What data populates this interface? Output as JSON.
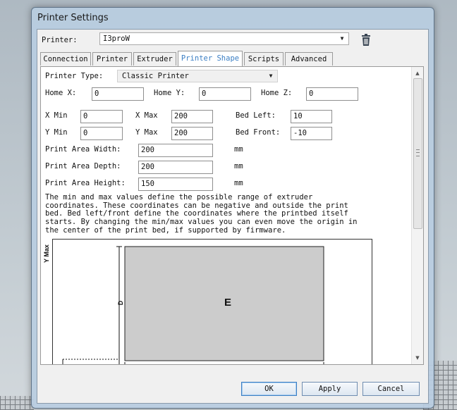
{
  "window": {
    "title": "Printer Settings"
  },
  "printer": {
    "label": "Printer:",
    "selected": "I3proW"
  },
  "tabs": [
    {
      "label": "Connection"
    },
    {
      "label": "Printer"
    },
    {
      "label": "Extruder"
    },
    {
      "label": "Printer Shape"
    },
    {
      "label": "Scripts"
    },
    {
      "label": "Advanced"
    }
  ],
  "shape": {
    "printer_type_label": "Printer Type:",
    "printer_type_value": "Classic Printer",
    "home_x_label": "Home X:",
    "home_x": "0",
    "home_y_label": "Home Y:",
    "home_y": "0",
    "home_z_label": "Home Z:",
    "home_z": "0",
    "x_min_label": "X Min",
    "x_min": "0",
    "x_max_label": "X Max",
    "x_max": "200",
    "y_min_label": "Y Min",
    "y_min": "0",
    "y_max_label": "Y Max",
    "y_max": "200",
    "bed_left_label": "Bed Left:",
    "bed_left": "10",
    "bed_front_label": "Bed Front:",
    "bed_front": "-10",
    "width_label": "Print Area Width:",
    "width": "200",
    "depth_label": "Print Area Depth:",
    "depth": "200",
    "height_label": "Print Area Height:",
    "height": "150",
    "unit": "mm",
    "help_text": "The min and max values define the possible range of extruder coordinates. These coordinates can be negative and outside the print bed. Bed left/front define the coordinates where the printbed itself starts. By changing the min/max values you can even move the origin in the center of the print bed, if supported by firmware."
  },
  "diagram": {
    "y_axis_label": "Y Max",
    "depth_marker": "D",
    "bed_marker": "E"
  },
  "footer": {
    "ok": "OK",
    "apply": "Apply",
    "cancel": "Cancel"
  },
  "colors": {
    "accent": "#3c7fc4",
    "bed_fill": "#cccccc"
  }
}
